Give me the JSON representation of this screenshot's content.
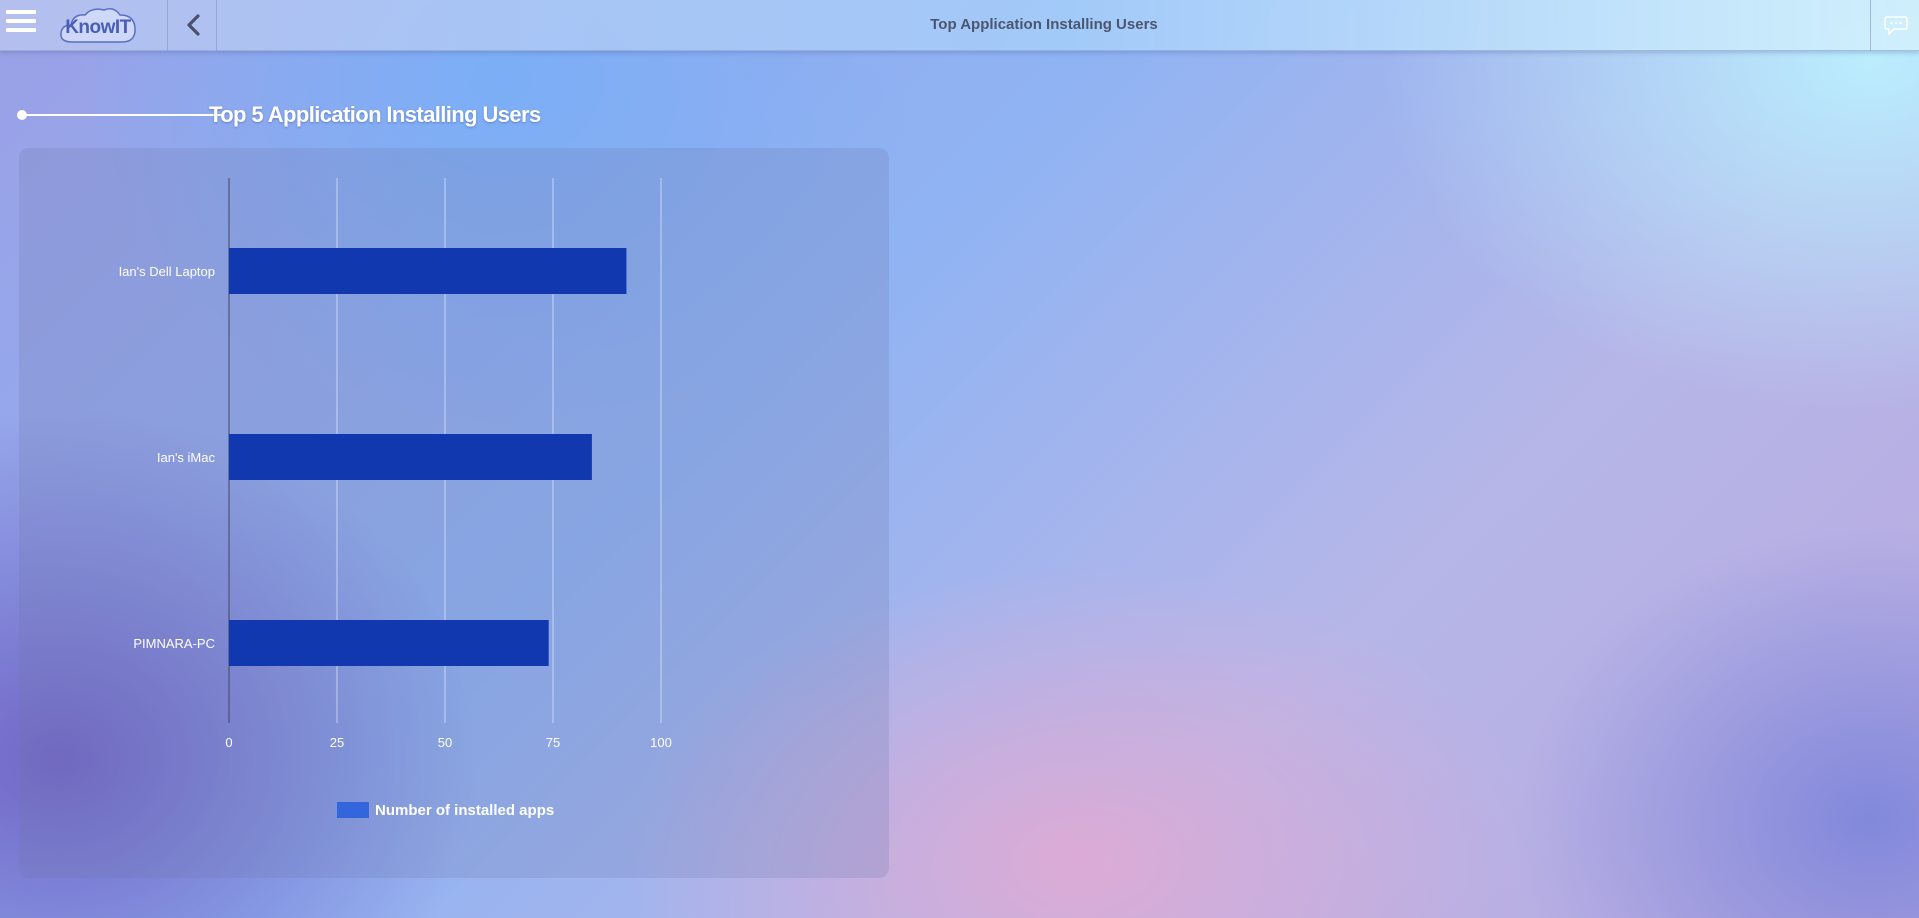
{
  "app": {
    "logo_text": "KnowIT",
    "page_title": "Top Application Installing Users"
  },
  "icons": {
    "menu": "hamburger-menu-icon",
    "back": "chevron-left-icon",
    "chat": "chat-bubble-icon",
    "logo": "cloud-logo-icon"
  },
  "section": {
    "title": "Top 5 Application Installing Users"
  },
  "chart_data": {
    "type": "bar",
    "orientation": "horizontal",
    "categories": [
      "Ian's Dell Laptop",
      "Ian's iMac",
      "PIMNARA-PC"
    ],
    "series": [
      {
        "name": "Number of installed apps",
        "values": [
          92,
          84,
          74
        ],
        "color": "#1238b0",
        "legend_color": "#3366dd"
      }
    ],
    "xlim": [
      0,
      100
    ],
    "xticks": [
      0,
      25,
      50,
      75,
      100
    ],
    "grid": true,
    "legend_position": "bottom"
  }
}
